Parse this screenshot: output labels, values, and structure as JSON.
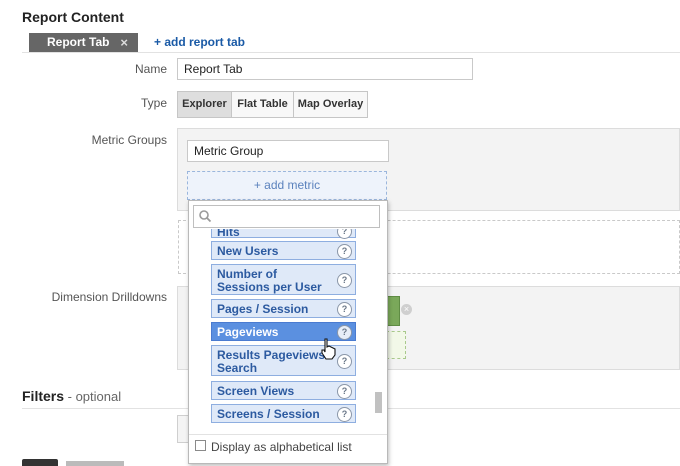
{
  "section": {
    "title": "Report Content"
  },
  "tabs": {
    "active_tab": "Report Tab",
    "close_glyph": "×",
    "add_tab": "+ add report tab"
  },
  "form": {
    "name_label": "Name",
    "name_value": "Report Tab",
    "type_label": "Type",
    "type_options": [
      "Explorer",
      "Flat Table",
      "Map Overlay"
    ],
    "type_selected": "Explorer",
    "metric_groups_label": "Metric Groups",
    "metric_group_value": "Metric Group",
    "add_metric": "+ add metric",
    "dimension_label": "Dimension Drilldowns"
  },
  "metric_dropdown": {
    "search_value": "",
    "items": [
      {
        "label": "Hits",
        "selected": false
      },
      {
        "label": "New Users",
        "selected": false
      },
      {
        "label": "Number of Sessions per User",
        "selected": false
      },
      {
        "label": "Pages / Session",
        "selected": false
      },
      {
        "label": "Pageviews",
        "selected": true
      },
      {
        "label": "Results Pageviews / Search",
        "selected": false
      },
      {
        "label": "Screen Views",
        "selected": false
      },
      {
        "label": "Screens / Session",
        "selected": false
      }
    ],
    "help_glyph": "?",
    "alphabetical_label": "Display as alphabetical list",
    "alphabetical_checked": false
  },
  "filters": {
    "title": "Filters",
    "optional": " - optional"
  },
  "colors": {
    "link": "#1a5aa6",
    "item_bg": "#dfe9f8",
    "item_selected": "#5b90e0",
    "green_box": "#7aa85a"
  }
}
